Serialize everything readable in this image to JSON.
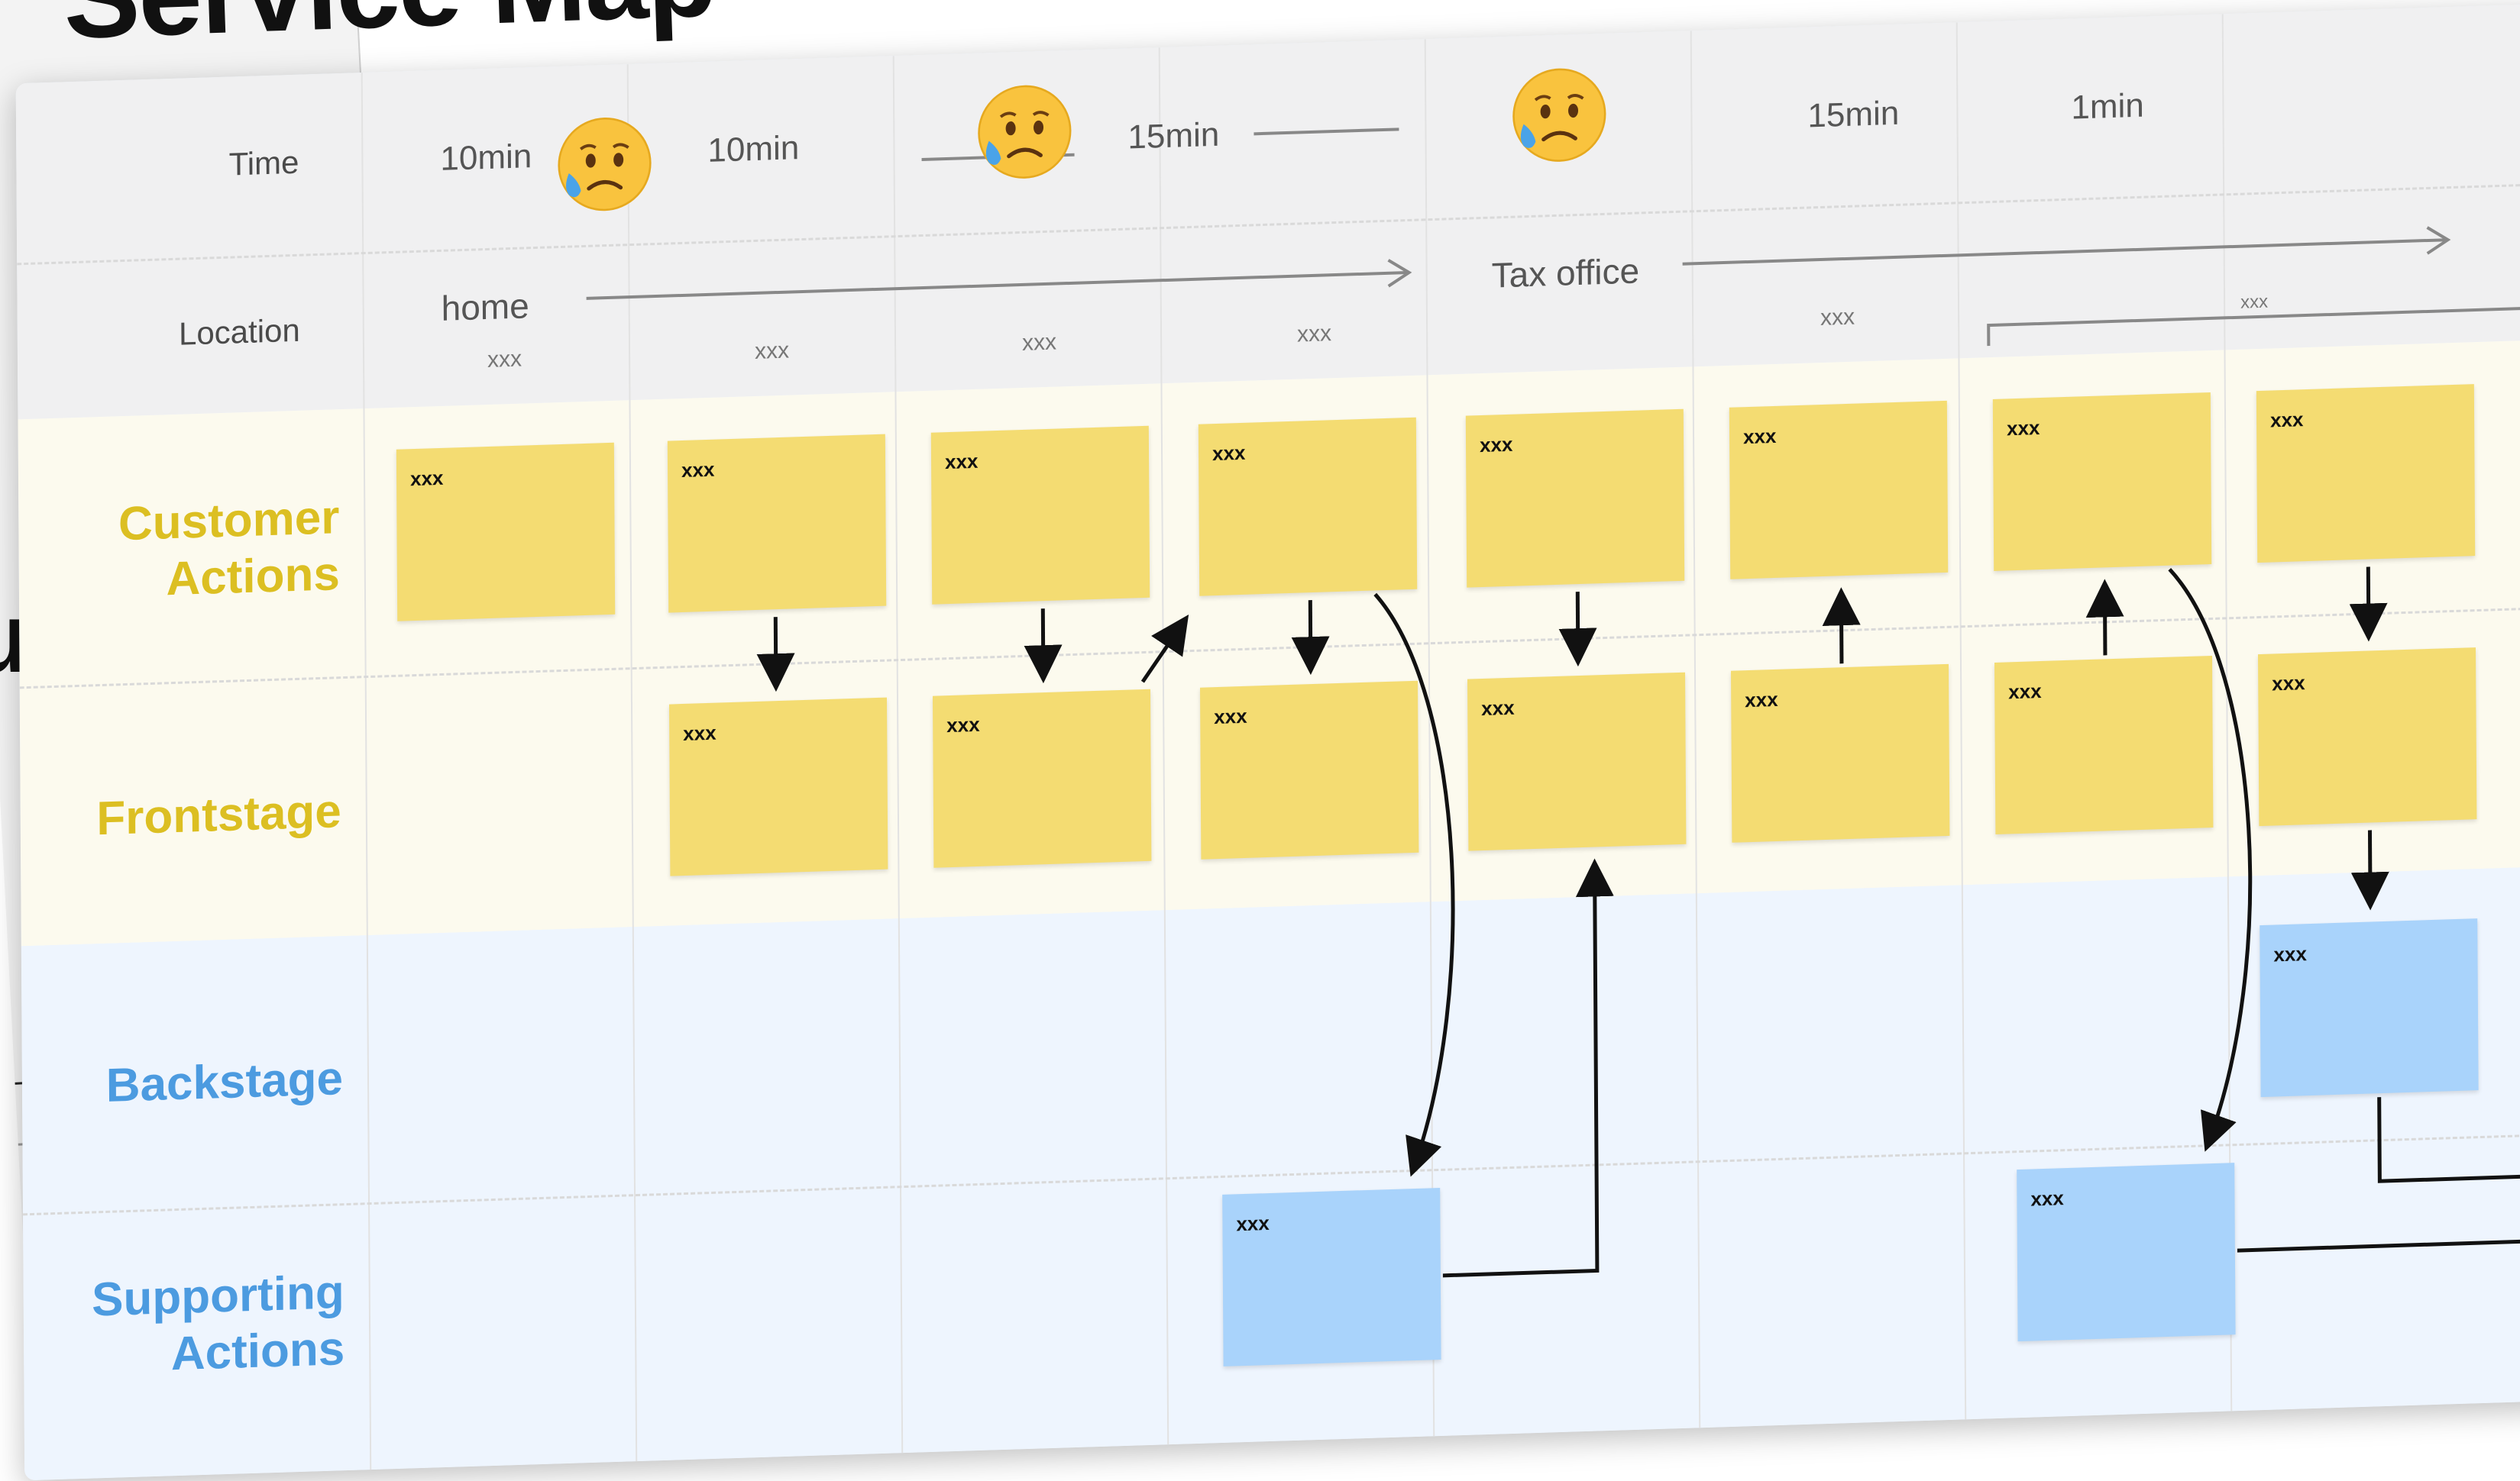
{
  "background": {
    "title_fragment": "Service Map",
    "side_letter": "u"
  },
  "rows": {
    "time": "Time",
    "location": "Location",
    "customer_actions": "Customer Actions",
    "frontstage": "Frontstage",
    "backstage": "Backstage",
    "supporting_actions": "Supporting Actions"
  },
  "times": [
    "10min",
    "10min",
    "15min",
    "15min",
    "1min"
  ],
  "locations": {
    "home": "home",
    "tax_office": "Tax office",
    "sub": [
      "xxx",
      "xxx",
      "xxx",
      "xxx",
      "xxx",
      "xxx"
    ]
  },
  "notes": {
    "customer": [
      "xxx",
      "xxx",
      "xxx",
      "xxx",
      "xxx",
      "xxx",
      "xxx",
      "xxx"
    ],
    "frontstage": [
      "xxx",
      "xxx",
      "xxx",
      "xxx",
      "xxx",
      "xxx",
      "xxx"
    ],
    "backstage": [
      "xxx"
    ],
    "support": [
      "xxx",
      "xxx"
    ]
  },
  "emotions": [
    "sad-tear-emoji",
    "sad-tear-emoji",
    "sad-tear-emoji"
  ],
  "colors": {
    "yellow_note": "#f4dc72",
    "blue_note": "#a9d3fb",
    "yellow_label": "#dcbf22",
    "blue_label": "#4c9be0"
  }
}
